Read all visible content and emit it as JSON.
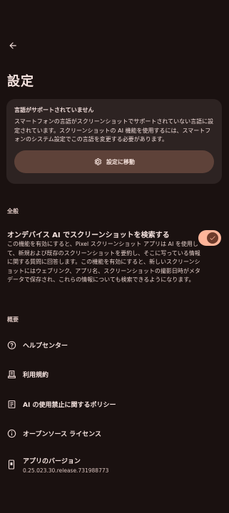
{
  "header": {
    "title": "設定"
  },
  "notice": {
    "title": "言語がサポートされていません",
    "body": "スマートフォンの言語がスクリーンショットでサポートされていない言語に設定されています。スクリーンショットの AI 機能を使用するには、スマートフォンのシステム設定でこの言語を変更する必要があります。",
    "button_label": "設定に移動"
  },
  "general": {
    "section_label": "全般",
    "ai_search": {
      "title": "オンデバイス AI でスクリーンショットを検索する",
      "description": "この機能を有効にすると、Pixel スクリーンショット アプリは AI を使用して、新規および既存のスクリーンショットを要約し、そこに写っている情報に関する質問に回答します。この機能を有効にすると、新しいスクリーンショットにはウェブリンク、アプリ名、スクリーンショットの撮影日時がメタデータで保存され、これらの情報についても検索できるようになります。",
      "enabled": true
    }
  },
  "about": {
    "section_label": "概要",
    "items": [
      {
        "label": "ヘルプセンター",
        "icon": "help-circle-icon"
      },
      {
        "label": "利用規約",
        "icon": "terms-document-icon"
      },
      {
        "label": "AI の使用禁止に関するポリシー",
        "icon": "policy-document-icon"
      },
      {
        "label": "オープンソース ライセンス",
        "icon": "info-circle-icon"
      }
    ],
    "version": {
      "label": "アプリのバージョン",
      "value": "0.25.023.30.release.731988773",
      "icon": "phone-icon"
    }
  },
  "colors": {
    "background": "#1a1110",
    "card": "#2d2322",
    "button": "#5e4239",
    "accent": "#ffb59a"
  }
}
